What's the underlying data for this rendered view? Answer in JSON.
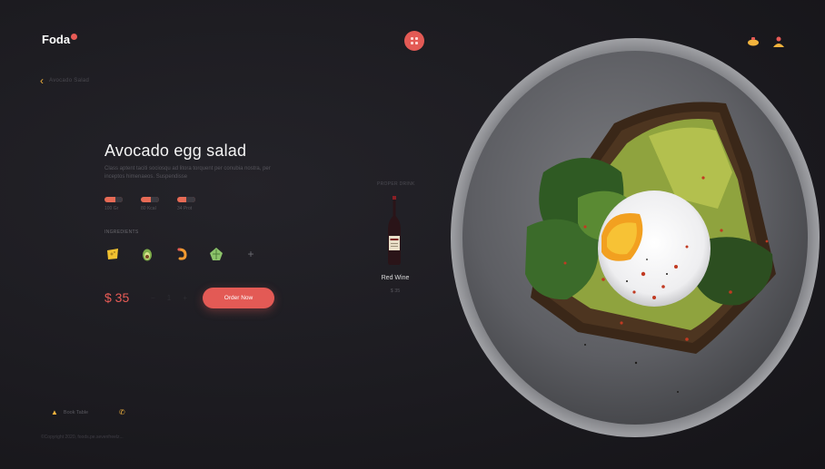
{
  "header": {
    "logo": "Foda",
    "center_button_icon": "grid-icon",
    "right_icons": [
      "pot-icon",
      "user-icon"
    ]
  },
  "back": {
    "label": "Avocado Salad"
  },
  "product": {
    "title": "Avocado egg salad",
    "description": "Class aptent taciti sociosqu ad litora torquent per conubia nostra, per inceptos himenaeos. Suspendisse",
    "stats": [
      {
        "label": "100 Gr",
        "fill": 0.6
      },
      {
        "label": "80 Kcal",
        "fill": 0.55
      },
      {
        "label": "34 Prot",
        "fill": 0.5
      }
    ],
    "ingredients_label": "INGREDIENTS",
    "ingredients": [
      {
        "name": "cheese-icon",
        "color": "#f2c230"
      },
      {
        "name": "avocado-icon",
        "color": "#7fae4a"
      },
      {
        "name": "shrimp-icon",
        "color": "#f29a30"
      },
      {
        "name": "lettuce-icon",
        "color": "#8cc36a"
      }
    ],
    "add_label": "+",
    "price": "$ 35",
    "qty_minus": "−",
    "qty_value": "1",
    "qty_plus": "+",
    "order_button": "Order Now"
  },
  "drink": {
    "section_label": "PROPER DRINK",
    "name": "Red Wine",
    "price": "$ 35"
  },
  "footer": {
    "book_table": "Book Table",
    "phone": "",
    "copyright": "©Copyright 2020, foods.pe.sevenfreelz..."
  },
  "colors": {
    "accent": "#e35a55",
    "yellow": "#f2b33d",
    "background": "#1c1b20"
  }
}
